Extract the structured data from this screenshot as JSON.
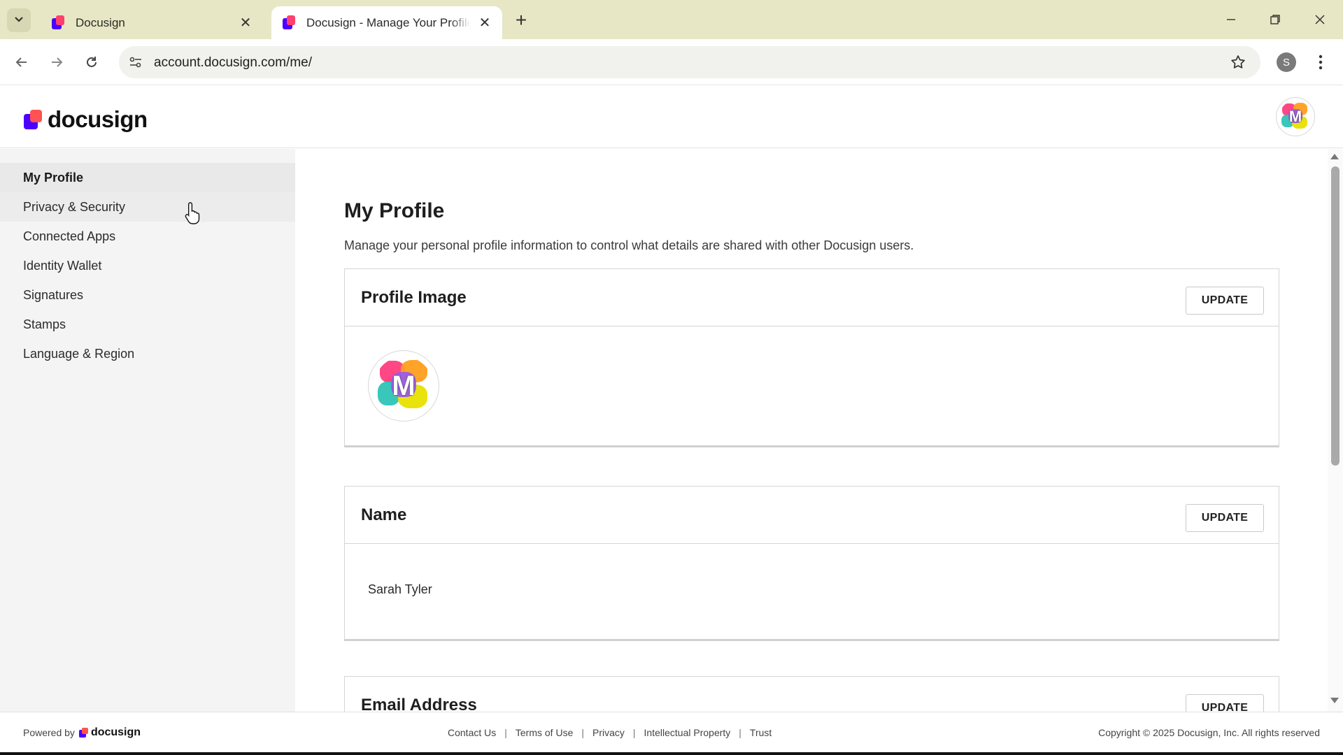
{
  "browser": {
    "tabs": [
      {
        "title": "Docusign",
        "active": false
      },
      {
        "title": "Docusign - Manage Your Profile",
        "active": true
      }
    ],
    "url": "account.docusign.com/me/",
    "profile_initial": "S"
  },
  "header": {
    "logo_text": "docusign",
    "avatar_letter": "M"
  },
  "sidebar": {
    "items": [
      {
        "label": "My Profile"
      },
      {
        "label": "Privacy & Security"
      },
      {
        "label": "Connected Apps"
      },
      {
        "label": "Identity Wallet"
      },
      {
        "label": "Signatures"
      },
      {
        "label": "Stamps"
      },
      {
        "label": "Language & Region"
      }
    ]
  },
  "main": {
    "title": "My Profile",
    "description": "Manage your personal profile information to control what details are shared with other Docusign users.",
    "cards": [
      {
        "title": "Profile Image",
        "button": "UPDATE",
        "avatar_letter": "M"
      },
      {
        "title": "Name",
        "button": "UPDATE",
        "value": "Sarah Tyler"
      },
      {
        "title": "Email Address",
        "button": "UPDATE"
      }
    ]
  },
  "footer": {
    "powered_by": "Powered by",
    "logo_text": "docusign",
    "links": [
      "Contact Us",
      "Terms of Use",
      "Privacy",
      "Intellectual Property",
      "Trust"
    ],
    "copyright": "Copyright © 2025 Docusign, Inc. All rights reserved"
  },
  "colors": {
    "brand_purple": "#4c00ff",
    "brand_coral": "#ff5252",
    "tabbar_bg": "#e7e7c5",
    "sidebar_bg": "#f4f4f4"
  },
  "icons": [
    "chevron-down-icon",
    "close-icon",
    "plus-icon",
    "minimize-icon",
    "restore-icon",
    "back-icon",
    "forward-icon",
    "reload-icon",
    "site-settings-icon",
    "bookmark-star-icon",
    "more-vert-icon",
    "hand-cursor-icon"
  ]
}
